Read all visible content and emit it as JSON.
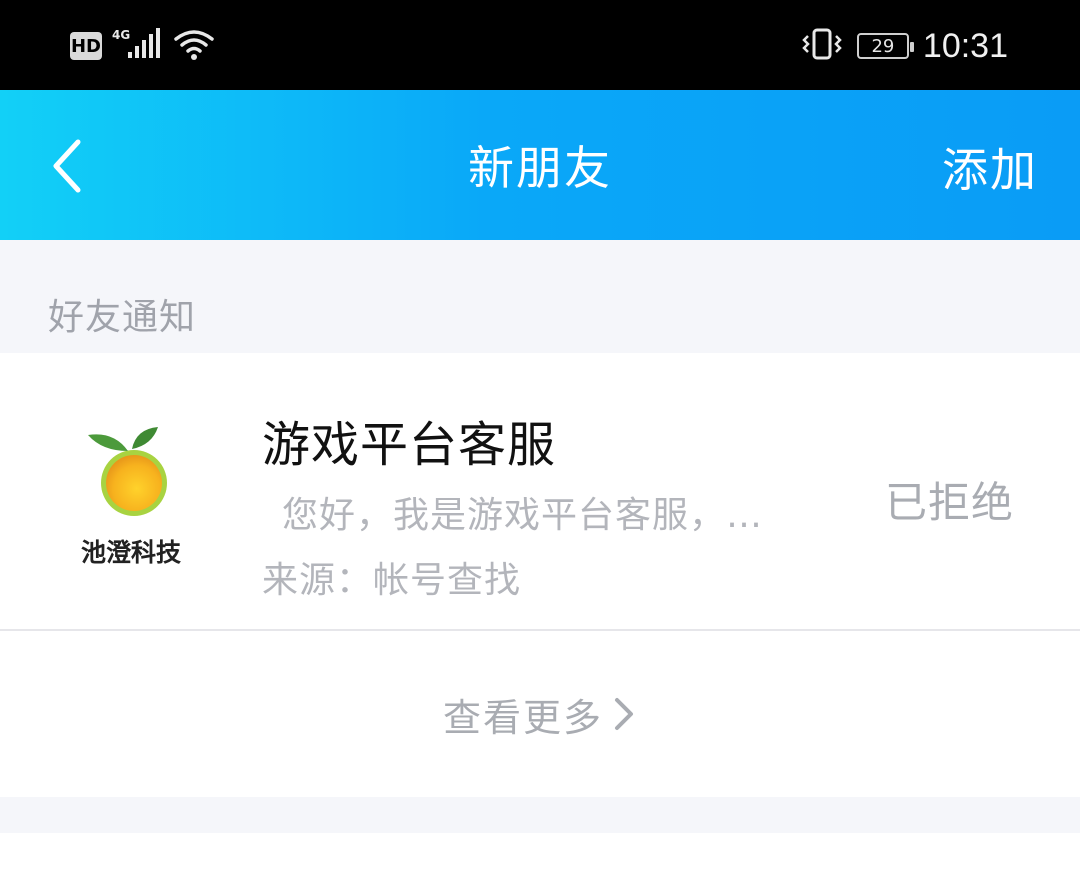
{
  "status_bar": {
    "hd_label": "HD",
    "network_label": "4G",
    "battery_level": "29",
    "time": "10:31",
    "icons": [
      "signal-icon",
      "wifi-icon",
      "vibrate-icon",
      "battery-icon"
    ]
  },
  "header": {
    "title": "新朋友",
    "action_label": "添加",
    "back_icon": "chevron-left-icon"
  },
  "section": {
    "label": "好友通知"
  },
  "notification": {
    "avatar_text": "池澄科技",
    "name": "游戏平台客服",
    "message": "您好，我是游戏平台客服，…",
    "source": "来源：帐号查找",
    "status": "已拒绝"
  },
  "see_more": {
    "label": "查看更多",
    "icon": "chevron-right-icon"
  },
  "colors": {
    "header_start": "#12d0f7",
    "header_end": "#0a9cf6",
    "background": "#f5f6fa",
    "muted_text": "#a9acb2"
  }
}
